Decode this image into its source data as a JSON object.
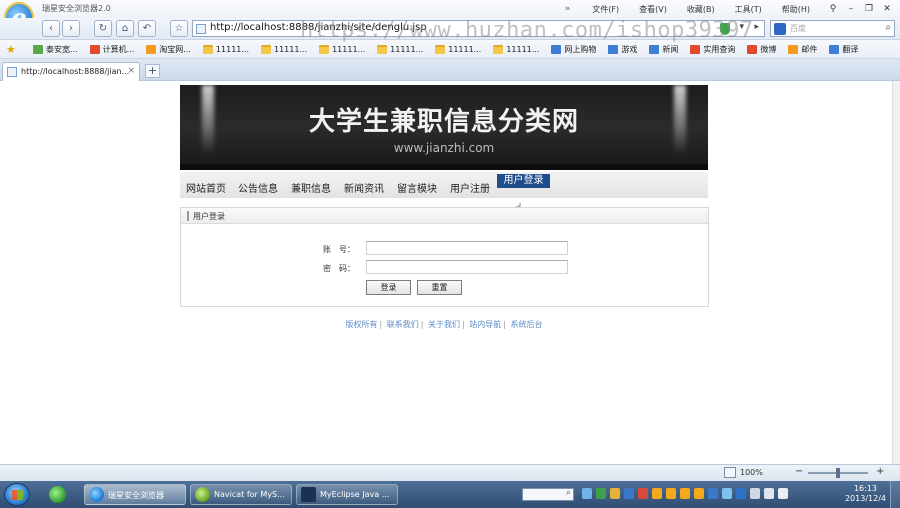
{
  "browser": {
    "app_title": "瑞星安全浏览器2.0",
    "menu": [
      "文件(F)",
      "查看(V)",
      "收藏(B)",
      "工具(T)",
      "帮助(H)"
    ],
    "menu_chevron": "»",
    "url": "http://localhost:8888/jianzhi/site/denglu.jsp",
    "search_placeholder": "百度",
    "watermark": "https://www.huzhan.com/ishop39397",
    "favorites": [
      {
        "label": "泰安宽...",
        "icon": "green"
      },
      {
        "label": "计算机...",
        "icon": "red"
      },
      {
        "label": "淘宝网...",
        "icon": "orange"
      },
      {
        "label": "11111...",
        "icon": "folder"
      },
      {
        "label": "11111...",
        "icon": "folder"
      },
      {
        "label": "11111...",
        "icon": "folder"
      },
      {
        "label": "11111...",
        "icon": "folder"
      },
      {
        "label": "11111...",
        "icon": "folder"
      },
      {
        "label": "11111...",
        "icon": "folder"
      },
      {
        "label": "网上购物",
        "icon": "blue"
      },
      {
        "label": "游戏",
        "icon": "blue"
      },
      {
        "label": "新闻",
        "icon": "blue"
      },
      {
        "label": "实用查询",
        "icon": "red"
      },
      {
        "label": "微博",
        "icon": "red"
      },
      {
        "label": "邮件",
        "icon": "orange"
      },
      {
        "label": "翻译",
        "icon": "blue"
      }
    ],
    "tab_title": "http://localhost:8888/jian...",
    "zoom": "100%"
  },
  "site": {
    "banner_title": "大学生兼职信息分类网",
    "banner_sub": "www.jianzhi.com",
    "nav": [
      "网站首页",
      "公告信息",
      "兼职信息",
      "新闻资讯",
      "留言模块",
      "用户注册"
    ],
    "nav_active": "用户登录",
    "panel_title": "用户登录",
    "account_label": "账　号：",
    "password_label": "密　码：",
    "account_value": "",
    "password_value": "",
    "login_button": "登录",
    "reset_button": "重置",
    "footer_links": [
      "版权所有",
      "联系我们",
      "关于我们",
      "站内导航",
      "系统后台"
    ]
  },
  "taskbar": {
    "tasks": [
      "瑞星安全浏览器",
      "Navicat for MyS...",
      "MyEclipse Java ..."
    ],
    "time": "16:13",
    "date": "2013/12/4"
  }
}
